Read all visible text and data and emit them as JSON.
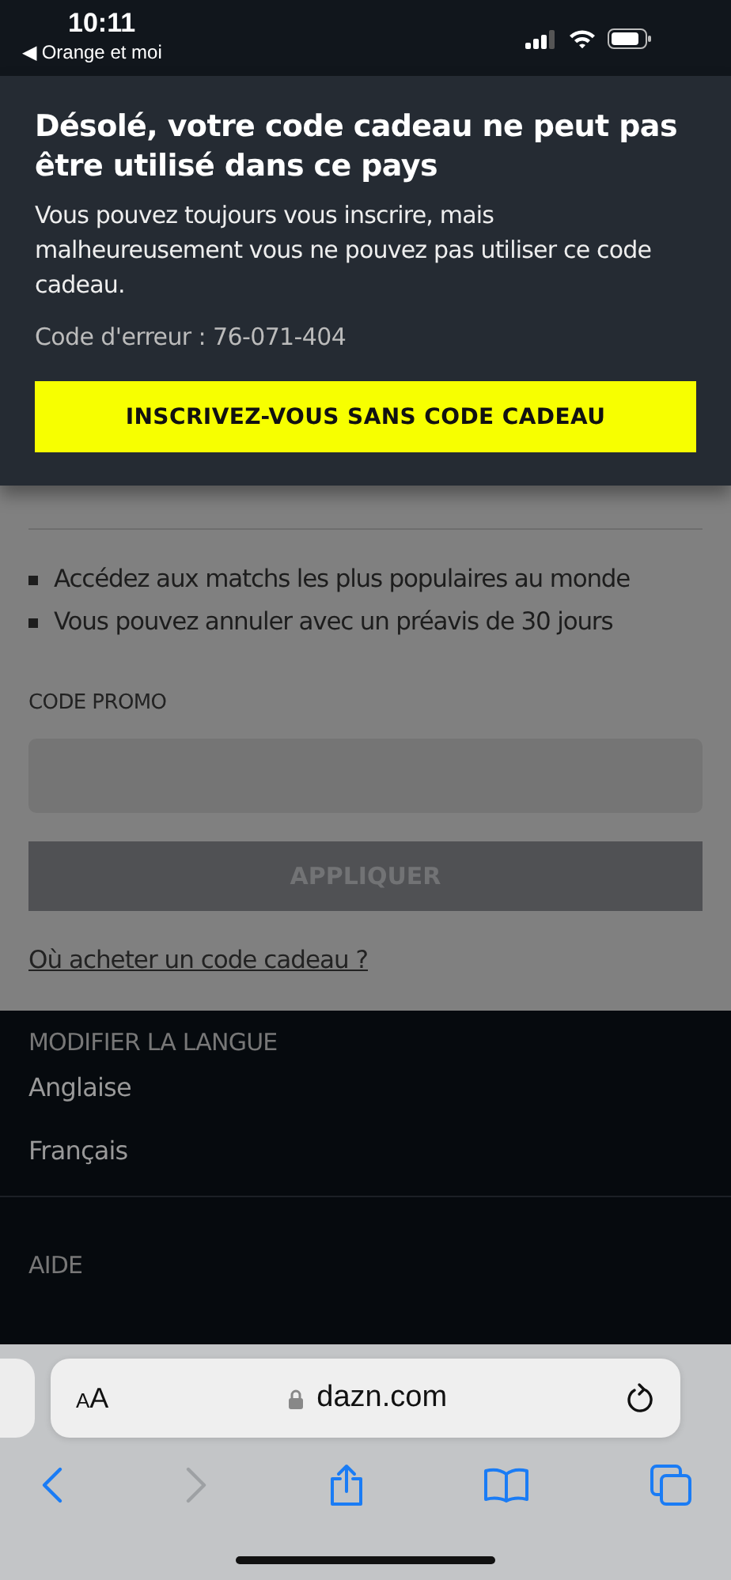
{
  "status_bar": {
    "time": "10:11",
    "back_app": "◀ Orange et moi"
  },
  "dialog": {
    "title": "Désolé, votre code cadeau ne peut pas être utilisé dans ce pays",
    "message": "Vous pouvez toujours vous inscrire, mais malheureusement vous ne pouvez pas utiliser ce code cadeau.",
    "error_code": "Code d'erreur : 76-071-404",
    "button": "INSCRIVEZ-VOUS SANS CODE CADEAU"
  },
  "page": {
    "benefits": [
      "Accédez aux matchs les plus populaires au monde",
      "Vous pouvez annuler avec un préavis de 30 jours"
    ],
    "promo_label": "CODE PROMO",
    "apply_button": {
      "label": "APPLIQUER",
      "disabled": true
    },
    "gift_link": "Où acheter un code cadeau ?"
  },
  "footer": {
    "language_heading": "MODIFIER LA LANGUE",
    "languages": [
      "Anglaise",
      "Français"
    ],
    "help_heading": "AIDE"
  },
  "browser": {
    "text_size": "AA",
    "url": "dazn.com",
    "toolbar": [
      {
        "kind": "back",
        "disabled": false
      },
      {
        "kind": "forward",
        "disabled": true
      },
      {
        "kind": "share",
        "disabled": false
      },
      {
        "kind": "bookmarks",
        "disabled": false
      },
      {
        "kind": "tabs",
        "disabled": false
      }
    ]
  }
}
